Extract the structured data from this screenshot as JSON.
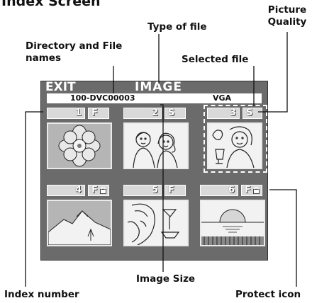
{
  "heading": "Index Screen",
  "callouts": {
    "picture_quality": "Picture Quality",
    "type_of_file": "Type of file",
    "directory_and_file_names": "Directory and File names",
    "selected_file": "Selected file",
    "image_size": "Image Size",
    "index_number": "Index number",
    "protect_icon": "Protect icon"
  },
  "screen": {
    "exit_label": "EXIT",
    "mode_label": "IMAGE",
    "directory": "100-DVC00003",
    "image_size": "VGA",
    "thumbnails": [
      {
        "index": "1",
        "quality": "F",
        "protected": false,
        "picture": "flower"
      },
      {
        "index": "2",
        "quality": "S",
        "protected": false,
        "picture": "couple"
      },
      {
        "index": "3",
        "quality": "S",
        "protected": false,
        "picture": "woman-drinking",
        "selected": true
      },
      {
        "index": "4",
        "quality": "F",
        "protected": true,
        "picture": "mountain"
      },
      {
        "index": "5",
        "quality": "F",
        "protected": false,
        "picture": "woman-portrait"
      },
      {
        "index": "6",
        "quality": "F",
        "protected": true,
        "picture": "sunset"
      }
    ]
  }
}
